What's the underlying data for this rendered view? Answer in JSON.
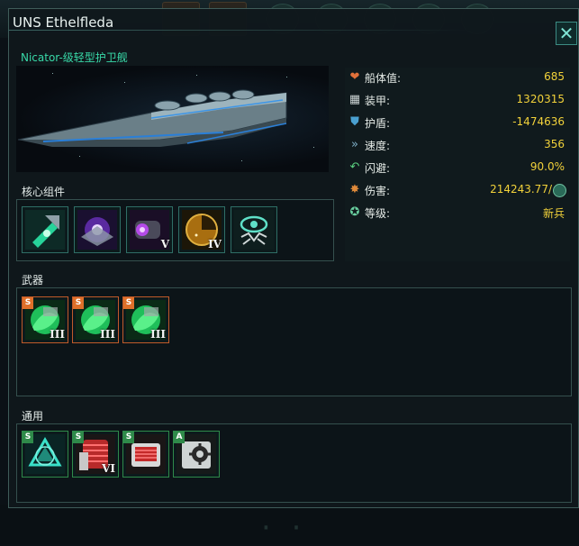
{
  "window": {
    "title": "UNS Ethelfleda",
    "subtitle": "Nicator-级轻型护卫舰",
    "close_icon": "close-icon"
  },
  "stats": [
    {
      "icon": "heart-icon",
      "label": "船体值:",
      "value": "685",
      "color": "#e0703a"
    },
    {
      "icon": "armor-icon",
      "label": "装甲:",
      "value": "1320315",
      "color": "#c8d0d0"
    },
    {
      "icon": "shield-icon",
      "label": "护盾:",
      "value": "-1474636",
      "color": "#4aa0d0"
    },
    {
      "icon": "speed-icon",
      "label": "速度:",
      "value": "356",
      "color": "#7fb0c8"
    },
    {
      "icon": "evasion-icon",
      "label": "闪避:",
      "value": "90.0%",
      "color": "#5ad080"
    },
    {
      "icon": "damage-icon",
      "label": "伤害:",
      "value": "214243.77/",
      "color": "#e08a3a"
    },
    {
      "icon": "rank-icon",
      "label": "等级:",
      "value": "新兵",
      "color": "#6ad0a0"
    }
  ],
  "sections": {
    "core": "核心组件",
    "weapons": "武器",
    "utility": "通用"
  },
  "core_components": [
    {
      "icon": "hyperdrive-icon",
      "roman": ""
    },
    {
      "icon": "reactor-icon",
      "roman": ""
    },
    {
      "icon": "thruster-icon",
      "roman": "V"
    },
    {
      "icon": "sensor-icon",
      "roman": "IV"
    },
    {
      "icon": "combat-computer-icon",
      "roman": ""
    }
  ],
  "weapons": [
    {
      "icon": "weapon-module-icon",
      "grade": "S",
      "roman": "III"
    },
    {
      "icon": "weapon-module-icon",
      "grade": "S",
      "roman": "III"
    },
    {
      "icon": "weapon-module-icon",
      "grade": "S",
      "roman": "III"
    }
  ],
  "utility": [
    {
      "icon": "shield-generator-icon",
      "grade": "S",
      "roman": ""
    },
    {
      "icon": "armor-plate-icon",
      "grade": "S",
      "roman": "VI"
    },
    {
      "icon": "armor-crate-icon",
      "grade": "S",
      "roman": ""
    },
    {
      "icon": "auxiliary-icon",
      "grade": "A",
      "roman": ""
    }
  ],
  "colors": {
    "accent": "#38d9a8",
    "value": "#f2d23a",
    "border": "#3f5c59"
  }
}
